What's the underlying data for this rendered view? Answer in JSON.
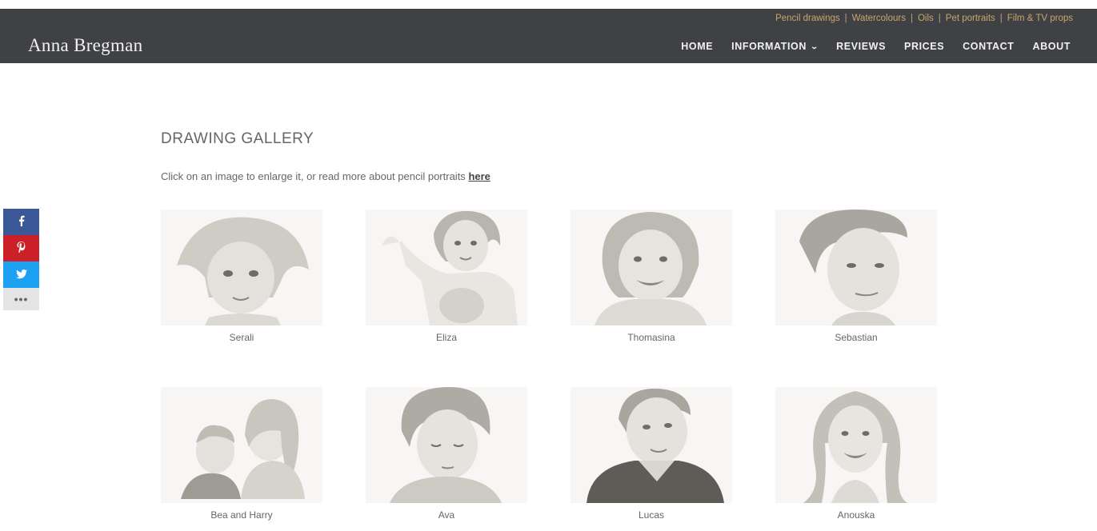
{
  "site": {
    "brand": "Anna Bregman",
    "secondary_nav": [
      "Pencil drawings",
      "Watercolours",
      "Oils",
      "Pet portraits",
      "Film & TV props"
    ],
    "secondary_sep": "|",
    "main_nav": [
      {
        "label": "HOME"
      },
      {
        "label": "INFORMATION"
      },
      {
        "label": "REVIEWS"
      },
      {
        "label": "PRICES"
      },
      {
        "label": "CONTACT"
      },
      {
        "label": "ABOUT"
      }
    ]
  },
  "page": {
    "title": "DRAWING GALLERY",
    "intro_text": "Click on an image to enlarge it, or read more about pencil portraits",
    "intro_link": "here"
  },
  "share": {
    "facebook": "f",
    "pinterest": "p",
    "twitter": "t",
    "more": "•••"
  },
  "gallery": [
    {
      "caption": "Serali"
    },
    {
      "caption": "Eliza"
    },
    {
      "caption": "Thomasina"
    },
    {
      "caption": "Sebastian"
    },
    {
      "caption": "Bea and Harry"
    },
    {
      "caption": "Ava"
    },
    {
      "caption": "Lucas"
    },
    {
      "caption": "Anouska"
    }
  ],
  "colors": {
    "header_bg": "#3f4145",
    "secondary_nav": "#c9a76a",
    "facebook": "#3b5998",
    "pinterest": "#cb2027",
    "twitter": "#1da1f2"
  }
}
